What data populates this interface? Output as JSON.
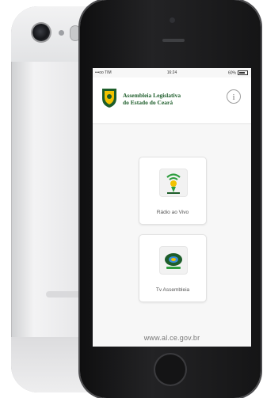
{
  "status_bar": {
    "carrier": "•••oo TIM",
    "time": "16:24",
    "battery": "60%"
  },
  "app": {
    "title_line1": "Assembleia Legislativa",
    "title_line2": "do Estado do Ceará",
    "info_symbol": "i"
  },
  "tiles": [
    {
      "label": "Rádio ao Vivo",
      "icon": "radio-icon"
    },
    {
      "label": "Tv Assembleia",
      "icon": "tv-icon"
    }
  ],
  "footer": {
    "url": "www.al.ce.gov.br"
  },
  "colors": {
    "brand_green": "#1d5d2a",
    "accent_yellow": "#f2c200"
  }
}
